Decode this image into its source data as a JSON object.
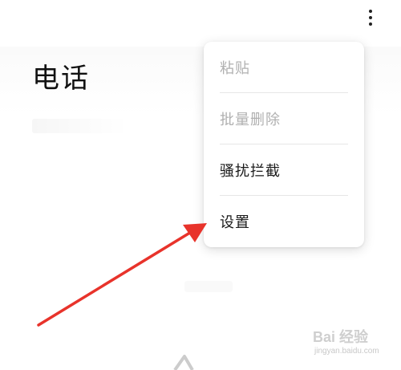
{
  "page": {
    "title": "电话"
  },
  "toolbar": {
    "more_icon": "more-vertical-icon"
  },
  "menu": {
    "items": [
      {
        "label": "粘贴",
        "enabled": false
      },
      {
        "label": "批量删除",
        "enabled": false
      },
      {
        "label": "骚扰拦截",
        "enabled": true
      },
      {
        "label": "设置",
        "enabled": true
      }
    ]
  },
  "annotation": {
    "arrow_color": "#e8332b"
  },
  "watermark": {
    "brand": "Bai 经验",
    "url": "jingyan.baidu.com"
  }
}
